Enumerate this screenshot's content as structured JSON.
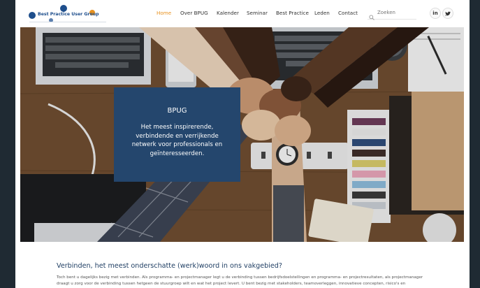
{
  "header": {
    "logo_text": "Best Practice User Group",
    "nav": [
      {
        "label": "Home",
        "active": true
      },
      {
        "label": "Over BPUG",
        "active": false
      },
      {
        "label": "Kalender",
        "active": false
      },
      {
        "label": "Seminar",
        "active": false
      },
      {
        "label": "Best Practice",
        "active": false
      },
      {
        "label": "Leden",
        "active": false
      },
      {
        "label": "Contact",
        "active": false
      }
    ],
    "search": {
      "placeholder": "Zoeken"
    },
    "social": {
      "linkedin": "in",
      "twitter": "t"
    }
  },
  "hero": {
    "title": "BPUG",
    "tagline": "Het meest inspirerende, verbindende en verrijkende netwerk voor professionals en geïnteresseerden."
  },
  "content": {
    "heading": "Verbinden, het meest onderschatte (werk)woord in ons vakgebied?",
    "body": "Toch bent u dagelijks bezig met verbinden. Als programma- en projectmanager legt u de verbinding tussen bedrijfsdoelstellingen en programma- en projectresultaten, als projectmanager draagt u zorg voor de verbinding tussen hetgeen de stuurgroep wilt en wat het project levert. U bent bezig met stakeholders, teamoverleggen, innovatieve concepten, risico's en maatregelen, enz. Of u nu"
  },
  "colors": {
    "accent": "#e8921f",
    "brand": "#1e4e8c",
    "hero_card": "#24466d",
    "heading": "#1f3e63"
  }
}
